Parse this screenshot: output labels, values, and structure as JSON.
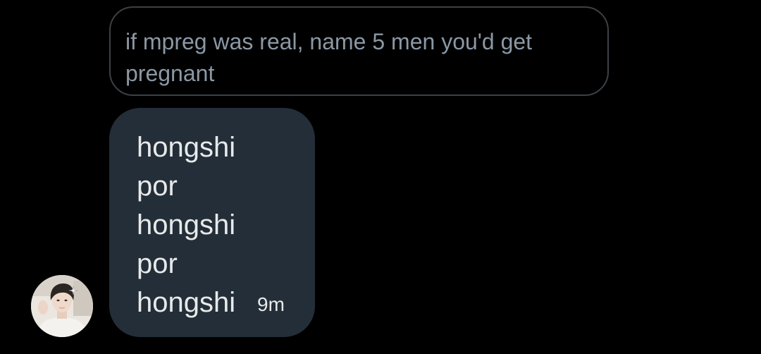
{
  "conversation": {
    "quoted_message": {
      "text": "if mpreg was real, name 5 men you'd get pregnant"
    },
    "reply_message": {
      "lines": [
        "hongshi",
        "por",
        "hongshi",
        "por",
        "hongshi"
      ],
      "timestamp": "9m"
    },
    "sender_avatar": {
      "icon": "profile-photo"
    }
  },
  "colors": {
    "background": "#000000",
    "quoted_border": "#3c4146",
    "quoted_text": "#8b98a5",
    "bubble_bg": "#232e38",
    "bubble_text": "#e7e9ea"
  }
}
